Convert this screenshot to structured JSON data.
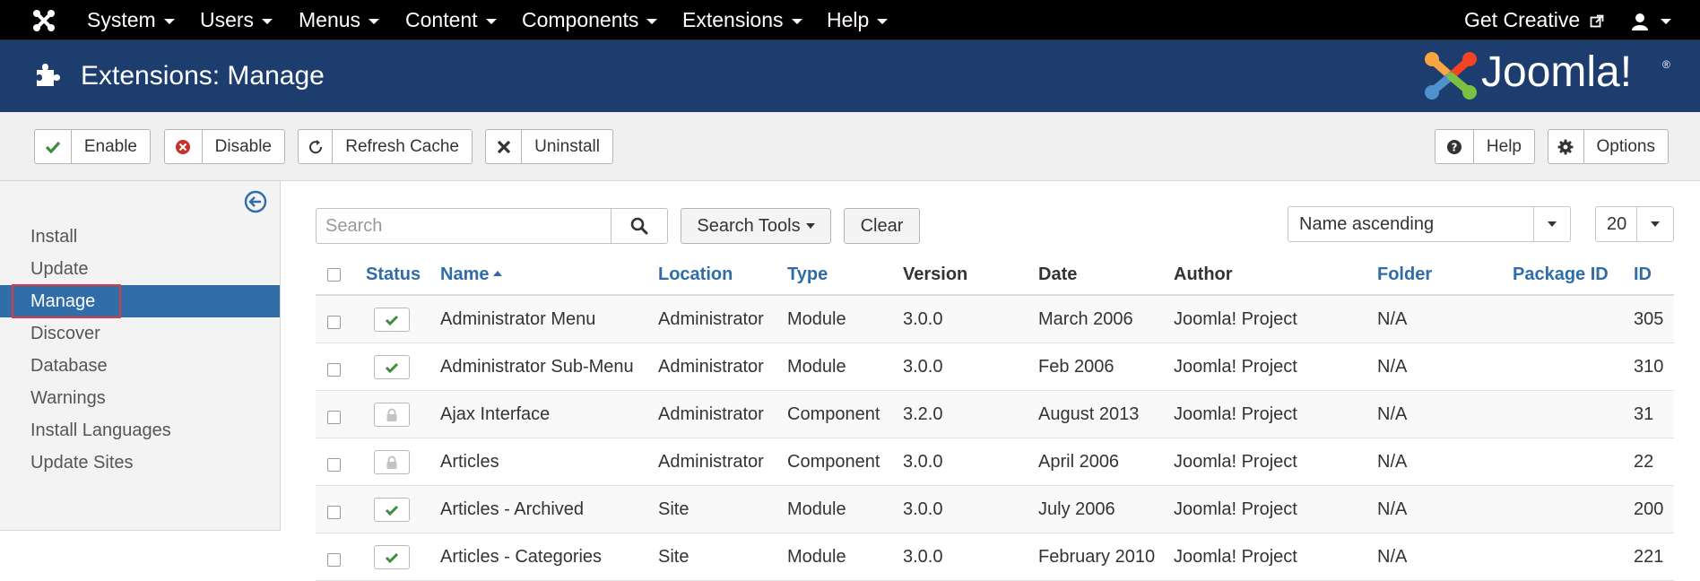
{
  "navbar": {
    "menus": [
      {
        "label": "System"
      },
      {
        "label": "Users"
      },
      {
        "label": "Menus"
      },
      {
        "label": "Content"
      },
      {
        "label": "Components"
      },
      {
        "label": "Extensions"
      },
      {
        "label": "Help"
      }
    ],
    "get_creative": "Get Creative",
    "icons": {
      "logo": "joomla-icon",
      "external": "external-link-icon",
      "user": "user-icon"
    }
  },
  "header": {
    "title": "Extensions: Manage",
    "brand": "Joomla!",
    "brand_mark": "®",
    "icons": {
      "page": "puzzle-piece-icon"
    }
  },
  "toolbar": {
    "enable": "Enable",
    "disable": "Disable",
    "refresh": "Refresh Cache",
    "uninstall": "Uninstall",
    "help": "Help",
    "options": "Options",
    "colors": {
      "enable_icon": "#3c8d3c",
      "disable_icon": "#c9302c"
    }
  },
  "sidebar": {
    "items": [
      {
        "label": "Install"
      },
      {
        "label": "Update"
      },
      {
        "label": "Manage",
        "active": true
      },
      {
        "label": "Discover"
      },
      {
        "label": "Database"
      },
      {
        "label": "Warnings"
      },
      {
        "label": "Install Languages"
      },
      {
        "label": "Update Sites"
      }
    ],
    "active_color": "#2f6ca8"
  },
  "filters": {
    "search_placeholder": "Search",
    "search_tools": "Search Tools",
    "clear": "Clear",
    "ordering": "Name ascending",
    "limit": "20"
  },
  "table": {
    "headers": {
      "status": "Status",
      "name": "Name",
      "location": "Location",
      "type": "Type",
      "version": "Version",
      "date": "Date",
      "author": "Author",
      "folder": "Folder",
      "package_id": "Package ID",
      "id": "ID"
    },
    "rows": [
      {
        "status": "enabled",
        "name": "Administrator Menu",
        "location": "Administrator",
        "type": "Module",
        "version": "3.0.0",
        "date": "March 2006",
        "author": "Joomla! Project",
        "folder": "N/A",
        "package_id": "",
        "id": "305"
      },
      {
        "status": "enabled",
        "name": "Administrator Sub-Menu",
        "location": "Administrator",
        "type": "Module",
        "version": "3.0.0",
        "date": "Feb 2006",
        "author": "Joomla! Project",
        "folder": "N/A",
        "package_id": "",
        "id": "310"
      },
      {
        "status": "locked",
        "name": "Ajax Interface",
        "location": "Administrator",
        "type": "Component",
        "version": "3.2.0",
        "date": "August 2013",
        "author": "Joomla! Project",
        "folder": "N/A",
        "package_id": "",
        "id": "31"
      },
      {
        "status": "locked",
        "name": "Articles",
        "location": "Administrator",
        "type": "Component",
        "version": "3.0.0",
        "date": "April 2006",
        "author": "Joomla! Project",
        "folder": "N/A",
        "package_id": "",
        "id": "22"
      },
      {
        "status": "enabled",
        "name": "Articles - Archived",
        "location": "Site",
        "type": "Module",
        "version": "3.0.0",
        "date": "July 2006",
        "author": "Joomla! Project",
        "folder": "N/A",
        "package_id": "",
        "id": "200"
      },
      {
        "status": "enabled",
        "name": "Articles - Categories",
        "location": "Site",
        "type": "Module",
        "version": "3.0.0",
        "date": "February 2010",
        "author": "Joomla! Project",
        "folder": "N/A",
        "package_id": "",
        "id": "221"
      }
    ]
  }
}
